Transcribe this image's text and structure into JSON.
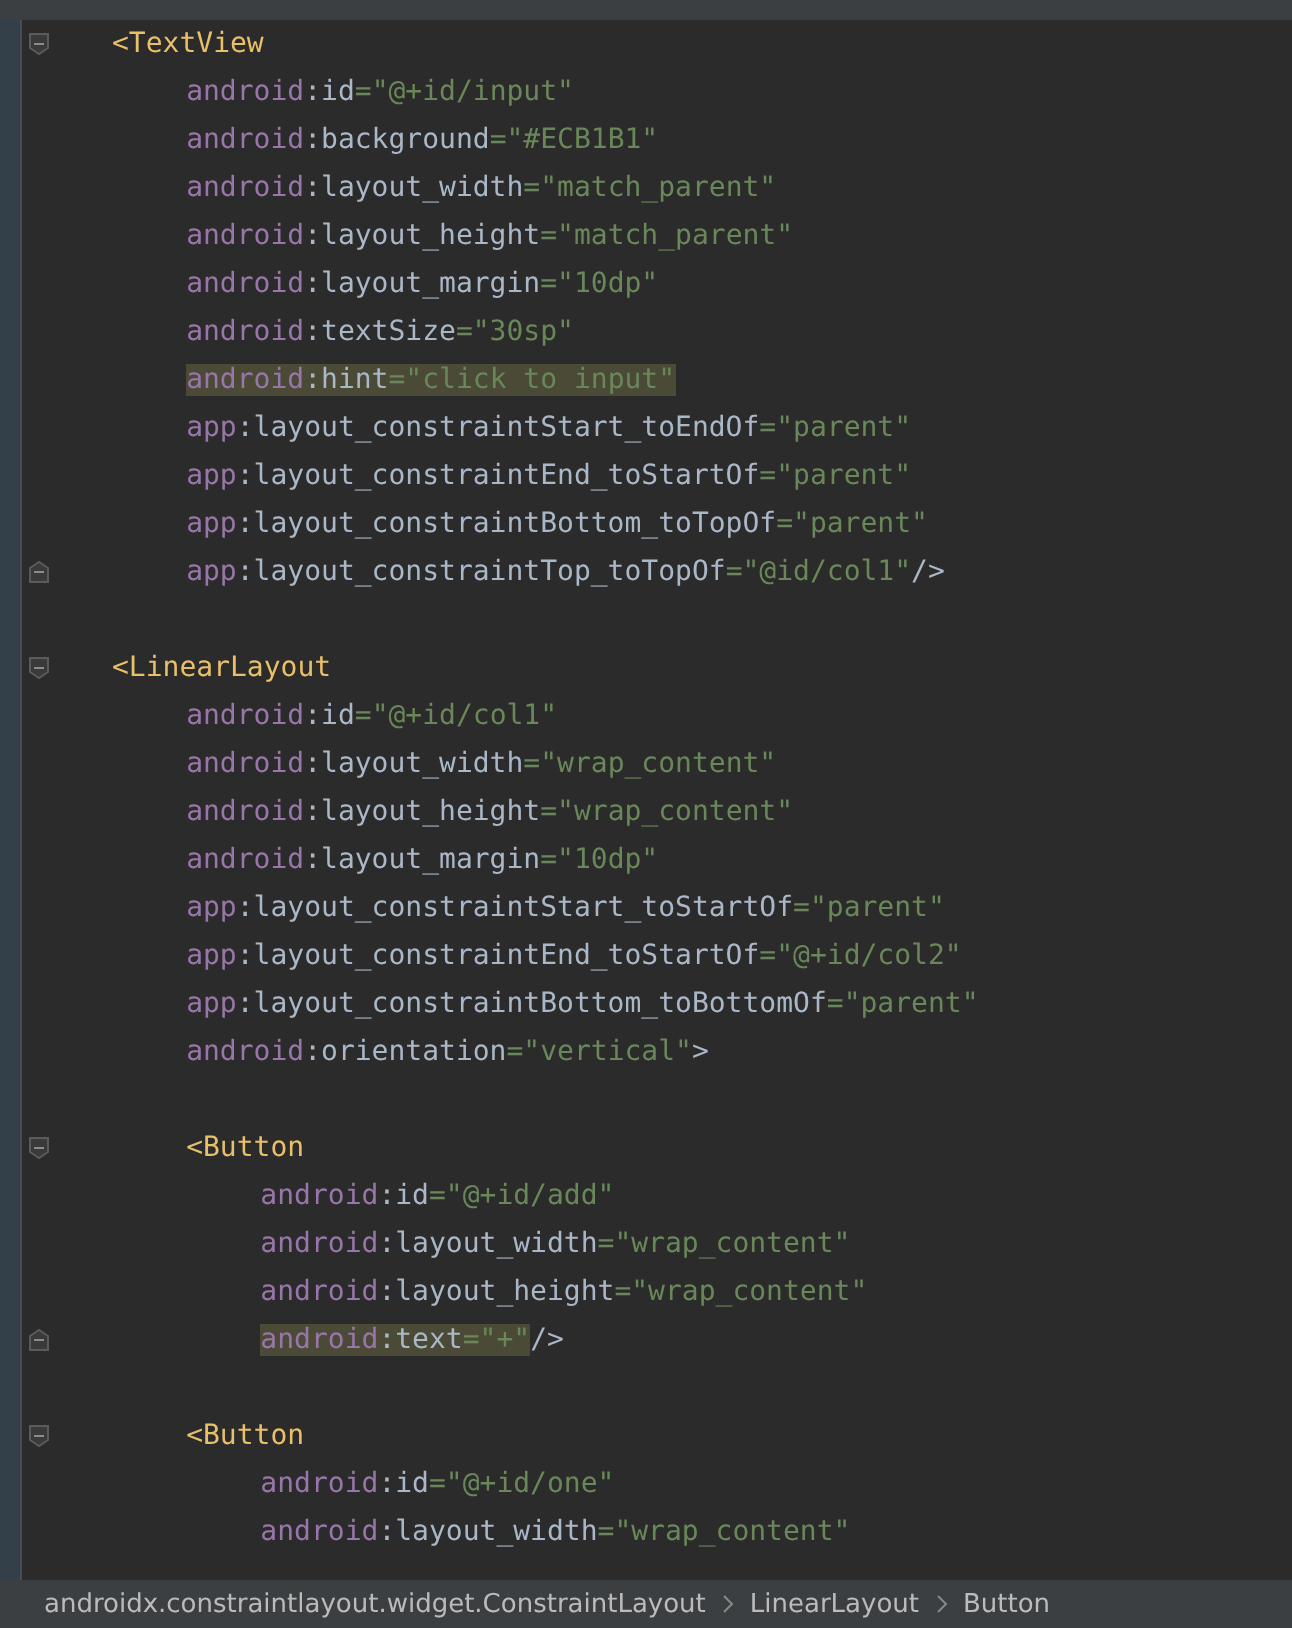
{
  "editor": {
    "elements": [
      {
        "tag": "<TextView",
        "end": "/>",
        "attributes": [
          {
            "ns": "android",
            "name": ":id",
            "value": "=\"@+id/input\"",
            "highlighted": false
          },
          {
            "ns": "android",
            "name": ":background",
            "value": "=\"#ECB1B1\"",
            "highlighted": false
          },
          {
            "ns": "android",
            "name": ":layout_width",
            "value": "=\"match_parent\"",
            "highlighted": false
          },
          {
            "ns": "android",
            "name": ":layout_height",
            "value": "=\"match_parent\"",
            "highlighted": false
          },
          {
            "ns": "android",
            "name": ":layout_margin",
            "value": "=\"10dp\"",
            "highlighted": false
          },
          {
            "ns": "android",
            "name": ":textSize",
            "value": "=\"30sp\"",
            "highlighted": false
          },
          {
            "ns": "android",
            "name": ":hint",
            "value": "=\"click to input\"",
            "highlighted": true
          },
          {
            "ns": "app",
            "name": ":layout_constraintStart_toEndOf",
            "value": "=\"parent\"",
            "highlighted": false
          },
          {
            "ns": "app",
            "name": ":layout_constraintEnd_toStartOf",
            "value": "=\"parent\"",
            "highlighted": false
          },
          {
            "ns": "app",
            "name": ":layout_constraintBottom_toTopOf",
            "value": "=\"parent\"",
            "highlighted": false
          },
          {
            "ns": "app",
            "name": ":layout_constraintTop_toTopOf",
            "value": "=\"@id/col1\"",
            "highlighted": false
          }
        ]
      },
      {
        "tag": "<LinearLayout",
        "end": ">",
        "attributes": [
          {
            "ns": "android",
            "name": ":id",
            "value": "=\"@+id/col1\"",
            "highlighted": false
          },
          {
            "ns": "android",
            "name": ":layout_width",
            "value": "=\"wrap_content\"",
            "highlighted": false
          },
          {
            "ns": "android",
            "name": ":layout_height",
            "value": "=\"wrap_content\"",
            "highlighted": false
          },
          {
            "ns": "android",
            "name": ":layout_margin",
            "value": "=\"10dp\"",
            "highlighted": false
          },
          {
            "ns": "app",
            "name": ":layout_constraintStart_toStartOf",
            "value": "=\"parent\"",
            "highlighted": false
          },
          {
            "ns": "app",
            "name": ":layout_constraintEnd_toStartOf",
            "value": "=\"@+id/col2\"",
            "highlighted": false
          },
          {
            "ns": "app",
            "name": ":layout_constraintBottom_toBottomOf",
            "value": "=\"parent\"",
            "highlighted": false
          },
          {
            "ns": "android",
            "name": ":orientation",
            "value": "=\"vertical\"",
            "highlighted": false
          }
        ],
        "children": [
          {
            "tag": "<Button",
            "end": "/>",
            "attributes": [
              {
                "ns": "android",
                "name": ":id",
                "value": "=\"@+id/add\"",
                "highlighted": false
              },
              {
                "ns": "android",
                "name": ":layout_width",
                "value": "=\"wrap_content\"",
                "highlighted": false
              },
              {
                "ns": "android",
                "name": ":layout_height",
                "value": "=\"wrap_content\"",
                "highlighted": false
              },
              {
                "ns": "android",
                "name": ":text",
                "value": "=\"+\"",
                "highlighted": true
              }
            ]
          },
          {
            "tag": "<Button",
            "attributes": [
              {
                "ns": "android",
                "name": ":id",
                "value": "=\"@+id/one\"",
                "highlighted": false
              },
              {
                "ns": "android",
                "name": ":layout_width",
                "value": "=\"wrap_content\"",
                "highlighted": false
              }
            ]
          }
        ]
      }
    ]
  },
  "breadcrumb": [
    "androidx.constraintlayout.widget.ConstraintLayout",
    "LinearLayout",
    "Button"
  ]
}
